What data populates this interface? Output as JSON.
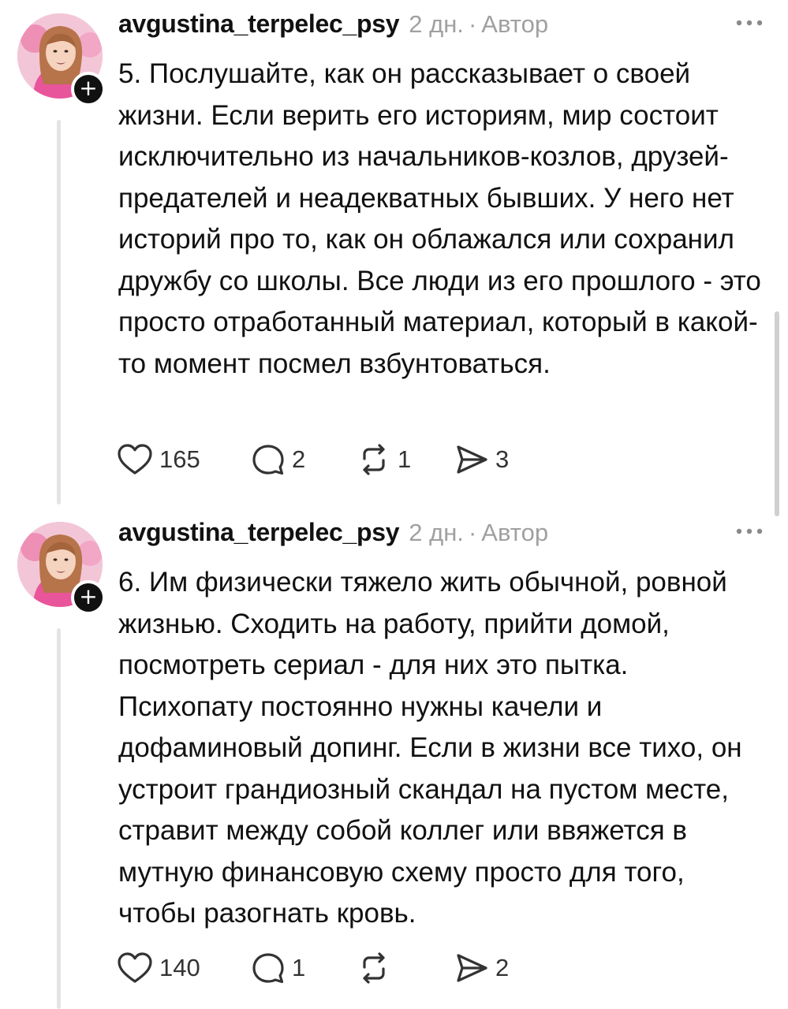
{
  "posts": [
    {
      "username": "avgustina_terpelec_psy",
      "time": "2 дн.",
      "separator": "·",
      "author_label": "Автор",
      "follow_glyph": "+",
      "text": "5. Послушайте, как он рассказывает о своей жизни. Если верить его историям, мир состоит исключительно из начальников-козлов, друзей-предателей и неадекватных бывших. У него нет историй про то, как он облажался или сохранил дружбу со школы. Все люди из его прошлого - это просто отработанный материал, который в какой-то момент посмел взбунтоваться.",
      "likes": "165",
      "replies": "2",
      "reposts": "1",
      "shares": "3"
    },
    {
      "username": "avgustina_terpelec_psy",
      "time": "2 дн.",
      "separator": "·",
      "author_label": "Автор",
      "follow_glyph": "+",
      "text": "6. Им физически тяжело жить обычной, ровной жизнью. Сходить на работу, прийти домой, посмотреть сериал - для них это пытка. Психопату постоянно нужны качели и дофаминовый допинг. Если в жизни все тихо, он устроит грандиозный скандал на пустом месте, стравит между собой коллег или ввяжется в мутную финансовую схему просто для того, чтобы разогнать кровь.",
      "likes": "140",
      "replies": "1",
      "reposts": "",
      "shares": "2"
    }
  ],
  "icons": {
    "like": "heart-icon",
    "reply": "comment-icon",
    "repost": "repost-icon",
    "share": "send-icon",
    "more": "more-horizontal-icon",
    "follow": "plus-icon"
  },
  "colors": {
    "text": "#111111",
    "muted": "#a0a0a0",
    "thread_line": "#e4e4e4",
    "avatar_bg": "#f3c6d7"
  }
}
